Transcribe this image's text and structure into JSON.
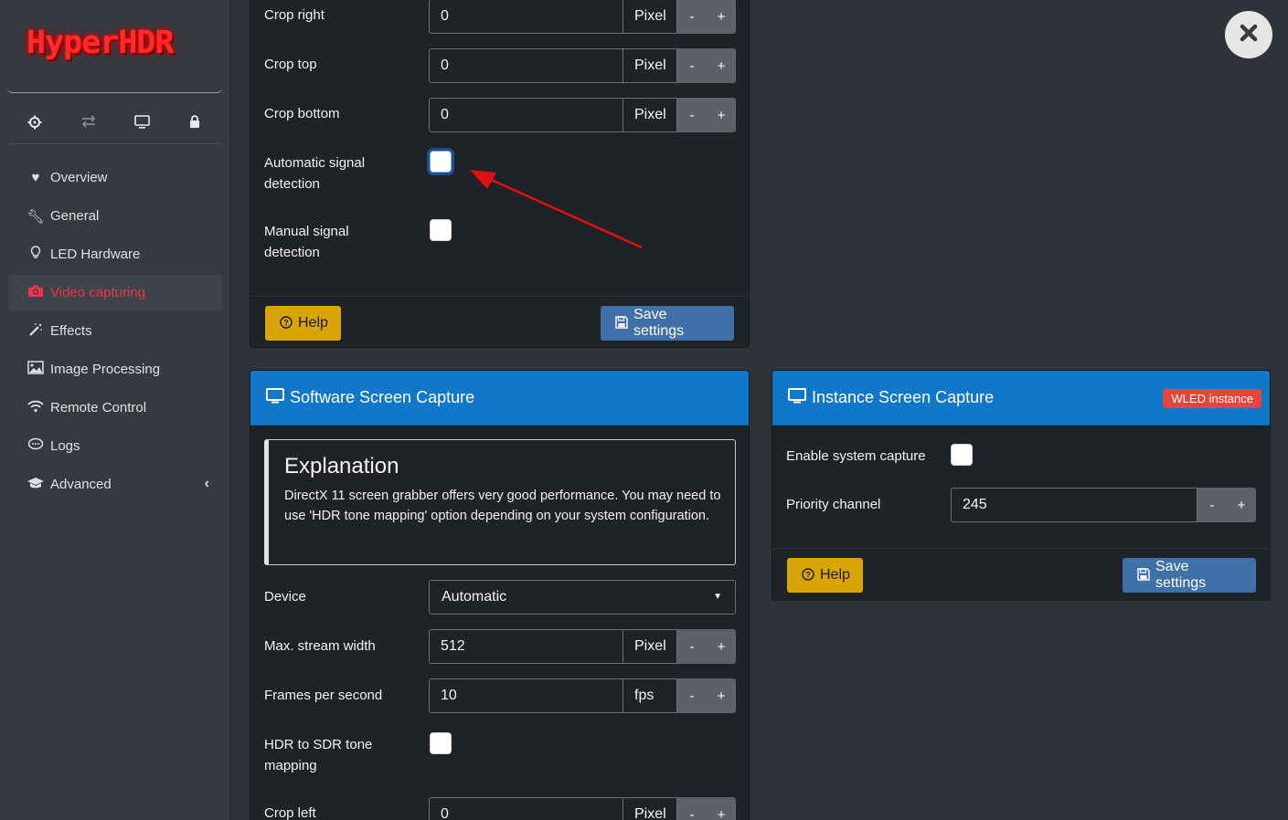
{
  "app": {
    "logo_text": "HyperHDR"
  },
  "sidebar": {
    "top_icons": [
      "gear-icon",
      "swap-icon",
      "monitor-icon",
      "lock-icon"
    ],
    "items": [
      {
        "label": "Overview",
        "icon": "heartbeat-icon"
      },
      {
        "label": "General",
        "icon": "wrench-icon"
      },
      {
        "label": "LED Hardware",
        "icon": "bulb-icon"
      },
      {
        "label": "Video capturing",
        "icon": "camera-icon",
        "active": true
      },
      {
        "label": "Effects",
        "icon": "magic-wand-icon"
      },
      {
        "label": "Image Processing",
        "icon": "image-icon"
      },
      {
        "label": "Remote Control",
        "icon": "wifi-icon"
      },
      {
        "label": "Logs",
        "icon": "chat-icon"
      },
      {
        "label": "Advanced",
        "icon": "graduation-cap-icon",
        "chevron": "‹"
      }
    ]
  },
  "top_panel": {
    "crop_right": {
      "label": "Crop right",
      "value": "0",
      "unit": "Pixel"
    },
    "crop_top": {
      "label": "Crop top",
      "value": "0",
      "unit": "Pixel"
    },
    "crop_bottom": {
      "label": "Crop bottom",
      "value": "0",
      "unit": "Pixel"
    },
    "auto_signal": {
      "label_1": "Automatic signal",
      "label_2": "detection",
      "checked": false
    },
    "manual_signal": {
      "label_1": "Manual signal",
      "label_2": "detection",
      "checked": false
    },
    "help_label": "Help",
    "save_label": "Save settings"
  },
  "software_panel": {
    "title": "Software Screen Capture",
    "explanation_title": "Explanation",
    "explanation_text": "DirectX 11 screen grabber offers very good performance. You may need to use 'HDR tone mapping' option depending on your system configuration.",
    "device": {
      "label": "Device",
      "value": "Automatic"
    },
    "max_width": {
      "label": "Max. stream width",
      "value": "512",
      "unit": "Pixel"
    },
    "fps": {
      "label": "Frames per second",
      "value": "10",
      "unit": "fps"
    },
    "hdr": {
      "label_1": "HDR to SDR tone",
      "label_2": "mapping",
      "checked": false
    },
    "crop_left": {
      "label": "Crop left",
      "value": "0",
      "unit": "Pixel"
    }
  },
  "instance_panel": {
    "title": "Instance Screen Capture",
    "badge": "WLED instance",
    "enable": {
      "label": "Enable system capture",
      "checked": false
    },
    "priority": {
      "label": "Priority channel",
      "value": "245"
    },
    "help_label": "Help",
    "save_label": "Save settings"
  },
  "stepper": {
    "minus": "-",
    "plus": "+"
  },
  "colors": {
    "accent_blue": "#1177c8",
    "help_yellow": "#d9a406",
    "save_blue": "#3f70a8",
    "active_red": "#e8364a",
    "badge_red": "#e5453a",
    "arrow_red": "#e01010"
  }
}
